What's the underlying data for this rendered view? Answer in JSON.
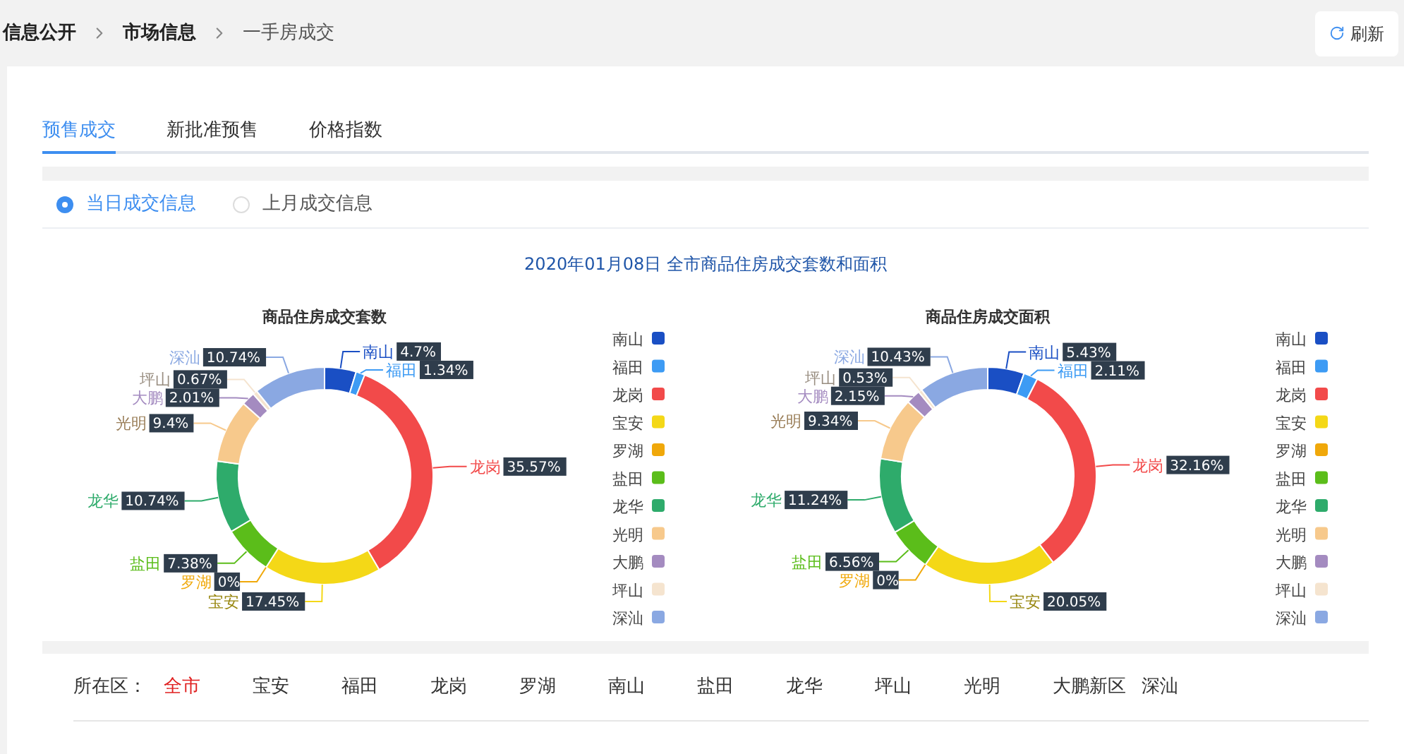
{
  "breadcrumb": [
    {
      "label": "信息公开",
      "current": false
    },
    {
      "label": "市场信息",
      "current": false
    },
    {
      "label": "一手房成交",
      "current": true
    }
  ],
  "refresh_button": {
    "label": "刷新"
  },
  "tabs": [
    {
      "label": "预售成交",
      "selected": true
    },
    {
      "label": "新批准预售",
      "selected": false
    },
    {
      "label": "价格指数",
      "selected": false
    }
  ],
  "radio_options": [
    {
      "label": "当日成交信息",
      "selected": true
    },
    {
      "label": "上月成交信息",
      "selected": false
    }
  ],
  "main_title": "2020年01月08日 全市商品住房成交套数和面积",
  "charts": [
    {
      "chart_data": {
        "type": "donut",
        "title": "商品住房成交套数",
        "legend": true,
        "categories": [
          "南山",
          "福田",
          "龙岗",
          "宝安",
          "罗湖",
          "盐田",
          "龙华",
          "光明",
          "大鹏",
          "坪山",
          "深汕"
        ],
        "values": [
          4.7,
          1.34,
          35.57,
          17.45,
          0,
          7.38,
          10.74,
          9.4,
          2.01,
          0.67,
          10.74
        ],
        "value_labels": [
          "4.7%",
          "1.34%",
          "35.57%",
          "17.45%",
          "0%",
          "7.38%",
          "10.74%",
          "9.4%",
          "2.01%",
          "0.67%",
          "10.74%"
        ],
        "colors": [
          "#1a4fc4",
          "#3d9bf4",
          "#f24a4a",
          "#f4d817",
          "#f0a80a",
          "#5bbd1a",
          "#2eab6b",
          "#f7c98c",
          "#a48bc0",
          "#f5e4cf",
          "#8aa8e2"
        ]
      }
    },
    {
      "chart_data": {
        "type": "donut",
        "title": "商品住房成交面积",
        "legend": true,
        "categories": [
          "南山",
          "福田",
          "龙岗",
          "宝安",
          "罗湖",
          "盐田",
          "龙华",
          "光明",
          "大鹏",
          "坪山",
          "深汕"
        ],
        "values": [
          5.43,
          2.11,
          32.16,
          20.05,
          0,
          6.56,
          11.24,
          9.34,
          2.15,
          0.53,
          10.43
        ],
        "value_labels": [
          "5.43%",
          "2.11%",
          "32.16%",
          "20.05%",
          "0%",
          "6.56%",
          "11.24%",
          "9.34%",
          "2.15%",
          "0.53%",
          "10.43%"
        ],
        "colors": [
          "#1a4fc4",
          "#3d9bf4",
          "#f24a4a",
          "#f4d817",
          "#f0a80a",
          "#5bbd1a",
          "#2eab6b",
          "#f7c98c",
          "#a48bc0",
          "#f5e4cf",
          "#8aa8e2"
        ]
      }
    }
  ],
  "district_filter": {
    "label": "所在区：",
    "options": [
      {
        "label": "全市",
        "selected": true
      },
      {
        "label": "宝安",
        "selected": false
      },
      {
        "label": "福田",
        "selected": false
      },
      {
        "label": "龙岗",
        "selected": false
      },
      {
        "label": "罗湖",
        "selected": false
      },
      {
        "label": "南山",
        "selected": false
      },
      {
        "label": "盐田",
        "selected": false
      },
      {
        "label": "龙华",
        "selected": false
      },
      {
        "label": "坪山",
        "selected": false
      },
      {
        "label": "光明",
        "selected": false
      },
      {
        "label": "大鹏新区",
        "selected": false
      },
      {
        "label": "深汕",
        "selected": false
      }
    ]
  }
}
